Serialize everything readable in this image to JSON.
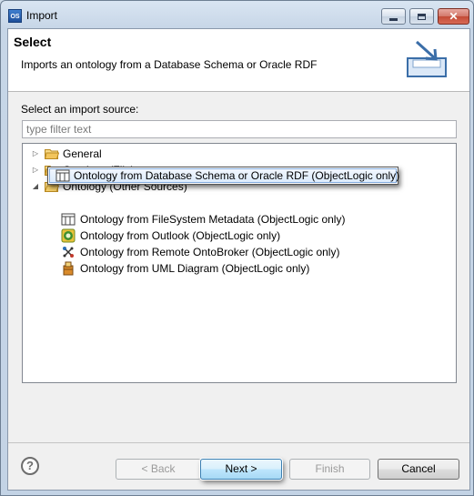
{
  "window": {
    "title": "Import",
    "app_icon_text": "OS"
  },
  "banner": {
    "title": "Select",
    "description": "Imports an ontology from a Database Schema or Oracle RDF"
  },
  "source_label": "Select an import source:",
  "filter": {
    "placeholder": "type filter text",
    "value": ""
  },
  "tree": {
    "groups": [
      {
        "label": "General",
        "expanded": false
      },
      {
        "label": "Ontology (File)",
        "expanded": false
      },
      {
        "label": "Ontology (Other Sources)",
        "expanded": true
      }
    ],
    "items": [
      {
        "label": "Ontology from Database Schema or Oracle RDF (ObjectLogic only)",
        "icon": "database-schema-icon",
        "selected": true
      },
      {
        "label": "Ontology from FileSystem Metadata (ObjectLogic only)",
        "icon": "filesystem-icon",
        "selected": false
      },
      {
        "label": "Ontology from Outlook (ObjectLogic only)",
        "icon": "outlook-icon",
        "selected": false
      },
      {
        "label": "Ontology from Remote OntoBroker (ObjectLogic only)",
        "icon": "ontobroker-icon",
        "selected": false
      },
      {
        "label": "Ontology from UML Diagram (ObjectLogic only)",
        "icon": "uml-icon",
        "selected": false
      }
    ]
  },
  "buttons": {
    "help": "?",
    "back": "< Back",
    "next": "Next >",
    "finish": "Finish",
    "cancel": "Cancel"
  },
  "colors": {
    "selection_border": "#84acdd",
    "folder_yellow": "#f2c55c"
  }
}
